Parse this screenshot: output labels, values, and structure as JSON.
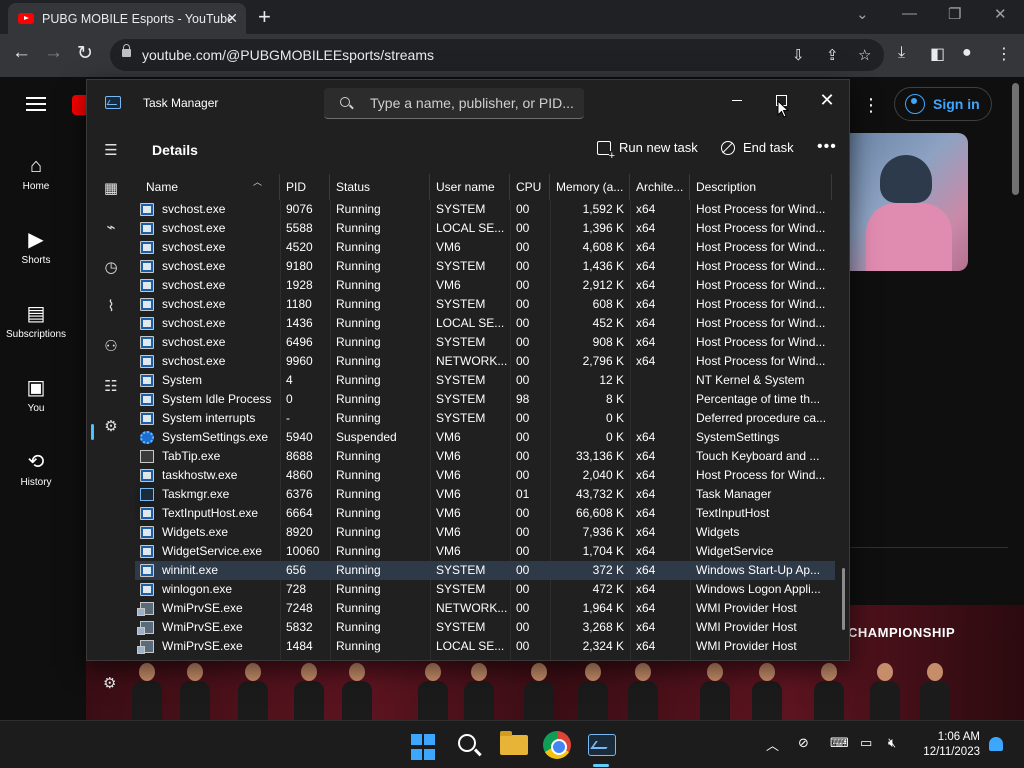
{
  "browser": {
    "tab_title": "PUBG MOBILE Esports - YouTube",
    "url": "youtube.com/@PUBGMOBILEEsports/streams"
  },
  "youtube": {
    "nav": [
      {
        "label": "Home",
        "icon": "home-icon"
      },
      {
        "label": "Shorts",
        "icon": "shorts-icon"
      },
      {
        "label": "Subscriptions",
        "icon": "subscriptions-icon"
      },
      {
        "label": "You",
        "icon": "you-icon"
      },
      {
        "label": "History",
        "icon": "history-icon"
      }
    ],
    "sign_in": "Sign in",
    "banner_title": "CHAMPIONSHIP"
  },
  "task_manager": {
    "title": "Task Manager",
    "search_placeholder": "Type a name, publisher, or PID...",
    "section_title": "Details",
    "run_new_task": "Run new task",
    "end_task": "End task",
    "columns": [
      "Name",
      "PID",
      "Status",
      "User name",
      "CPU",
      "Memory (a...",
      "Archite...",
      "Description"
    ],
    "rows": [
      {
        "name": "svchost.exe",
        "pid": "9076",
        "status": "Running",
        "user": "SYSTEM",
        "cpu": "00",
        "mem": "1,592 K",
        "arch": "x64",
        "desc": "Host Process for Wind...",
        "icon": "svc"
      },
      {
        "name": "svchost.exe",
        "pid": "5588",
        "status": "Running",
        "user": "LOCAL SE...",
        "cpu": "00",
        "mem": "1,396 K",
        "arch": "x64",
        "desc": "Host Process for Wind...",
        "icon": "svc"
      },
      {
        "name": "svchost.exe",
        "pid": "4520",
        "status": "Running",
        "user": "VM6",
        "cpu": "00",
        "mem": "4,608 K",
        "arch": "x64",
        "desc": "Host Process for Wind...",
        "icon": "svc"
      },
      {
        "name": "svchost.exe",
        "pid": "9180",
        "status": "Running",
        "user": "SYSTEM",
        "cpu": "00",
        "mem": "1,436 K",
        "arch": "x64",
        "desc": "Host Process for Wind...",
        "icon": "svc"
      },
      {
        "name": "svchost.exe",
        "pid": "1928",
        "status": "Running",
        "user": "VM6",
        "cpu": "00",
        "mem": "2,912 K",
        "arch": "x64",
        "desc": "Host Process for Wind...",
        "icon": "svc"
      },
      {
        "name": "svchost.exe",
        "pid": "1180",
        "status": "Running",
        "user": "SYSTEM",
        "cpu": "00",
        "mem": "608 K",
        "arch": "x64",
        "desc": "Host Process for Wind...",
        "icon": "svc"
      },
      {
        "name": "svchost.exe",
        "pid": "1436",
        "status": "Running",
        "user": "LOCAL SE...",
        "cpu": "00",
        "mem": "452 K",
        "arch": "x64",
        "desc": "Host Process for Wind...",
        "icon": "svc"
      },
      {
        "name": "svchost.exe",
        "pid": "6496",
        "status": "Running",
        "user": "SYSTEM",
        "cpu": "00",
        "mem": "908 K",
        "arch": "x64",
        "desc": "Host Process for Wind...",
        "icon": "svc"
      },
      {
        "name": "svchost.exe",
        "pid": "9960",
        "status": "Running",
        "user": "NETWORK...",
        "cpu": "00",
        "mem": "2,796 K",
        "arch": "x64",
        "desc": "Host Process for Wind...",
        "icon": "svc"
      },
      {
        "name": "System",
        "pid": "4",
        "status": "Running",
        "user": "SYSTEM",
        "cpu": "00",
        "mem": "12 K",
        "arch": "",
        "desc": "NT Kernel & System",
        "icon": "svc"
      },
      {
        "name": "System Idle Process",
        "pid": "0",
        "status": "Running",
        "user": "SYSTEM",
        "cpu": "98",
        "mem": "8 K",
        "arch": "",
        "desc": "Percentage of time th...",
        "icon": "svc"
      },
      {
        "name": "System interrupts",
        "pid": "-",
        "status": "Running",
        "user": "SYSTEM",
        "cpu": "00",
        "mem": "0 K",
        "arch": "",
        "desc": "Deferred procedure ca...",
        "icon": "svc"
      },
      {
        "name": "SystemSettings.exe",
        "pid": "5940",
        "status": "Suspended",
        "user": "VM6",
        "cpu": "00",
        "mem": "0 K",
        "arch": "x64",
        "desc": "SystemSettings",
        "icon": "gear"
      },
      {
        "name": "TabTip.exe",
        "pid": "8688",
        "status": "Running",
        "user": "VM6",
        "cpu": "00",
        "mem": "33,136 K",
        "arch": "x64",
        "desc": "Touch Keyboard and ...",
        "icon": "kbd"
      },
      {
        "name": "taskhostw.exe",
        "pid": "4860",
        "status": "Running",
        "user": "VM6",
        "cpu": "00",
        "mem": "2,040 K",
        "arch": "x64",
        "desc": "Host Process for Wind...",
        "icon": "svc"
      },
      {
        "name": "Taskmgr.exe",
        "pid": "6376",
        "status": "Running",
        "user": "VM6",
        "cpu": "01",
        "mem": "43,732 K",
        "arch": "x64",
        "desc": "Task Manager",
        "icon": "tm"
      },
      {
        "name": "TextInputHost.exe",
        "pid": "6664",
        "status": "Running",
        "user": "VM6",
        "cpu": "00",
        "mem": "66,608 K",
        "arch": "x64",
        "desc": "TextInputHost",
        "icon": "svc"
      },
      {
        "name": "Widgets.exe",
        "pid": "8920",
        "status": "Running",
        "user": "VM6",
        "cpu": "00",
        "mem": "7,936 K",
        "arch": "x64",
        "desc": "Widgets",
        "icon": "svc"
      },
      {
        "name": "WidgetService.exe",
        "pid": "10060",
        "status": "Running",
        "user": "VM6",
        "cpu": "00",
        "mem": "1,704 K",
        "arch": "x64",
        "desc": "WidgetService",
        "icon": "svc"
      },
      {
        "name": "wininit.exe",
        "pid": "656",
        "status": "Running",
        "user": "SYSTEM",
        "cpu": "00",
        "mem": "372 K",
        "arch": "x64",
        "desc": "Windows Start-Up Ap...",
        "icon": "svc",
        "selected": true
      },
      {
        "name": "winlogon.exe",
        "pid": "728",
        "status": "Running",
        "user": "SYSTEM",
        "cpu": "00",
        "mem": "472 K",
        "arch": "x64",
        "desc": "Windows Logon Appli...",
        "icon": "svc"
      },
      {
        "name": "WmiPrvSE.exe",
        "pid": "7248",
        "status": "Running",
        "user": "NETWORK...",
        "cpu": "00",
        "mem": "1,964 K",
        "arch": "x64",
        "desc": "WMI Provider Host",
        "icon": "wmi"
      },
      {
        "name": "WmiPrvSE.exe",
        "pid": "5832",
        "status": "Running",
        "user": "SYSTEM",
        "cpu": "00",
        "mem": "3,268 K",
        "arch": "x64",
        "desc": "WMI Provider Host",
        "icon": "wmi"
      },
      {
        "name": "WmiPrvSE.exe",
        "pid": "1484",
        "status": "Running",
        "user": "LOCAL SE...",
        "cpu": "00",
        "mem": "2,324 K",
        "arch": "x64",
        "desc": "WMI Provider Host",
        "icon": "wmi"
      }
    ]
  },
  "taskbar": {
    "time": "1:06 AM",
    "date": "12/11/2023"
  }
}
